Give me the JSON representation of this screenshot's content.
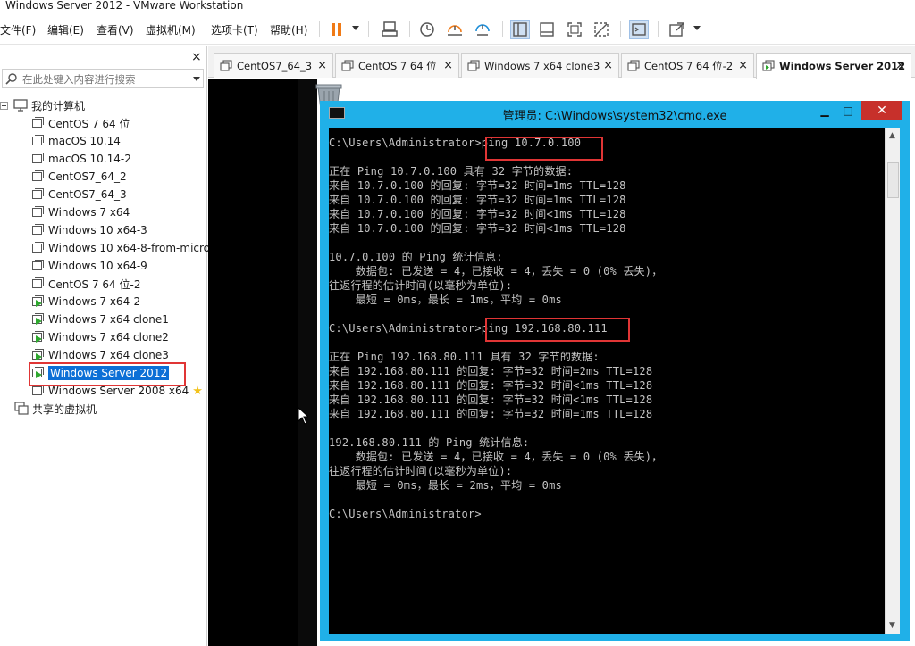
{
  "window": {
    "title": "Windows Server 2012 - VMware Workstation"
  },
  "menu": {
    "items": [
      "文件(F)",
      "编辑(E)",
      "查看(V)",
      "虚拟机(M)",
      "选项卡(T)",
      "帮助(H)"
    ]
  },
  "toolbar": {
    "icons": [
      "pause-icon",
      "send-ctrl-alt-del-icon",
      "snapshot-icon",
      "revert-snapshot-icon",
      "manage-snapshots-icon",
      "show-library-icon",
      "thumbnail-bar-icon",
      "full-screen-icon",
      "unity-icon",
      "console-view-icon",
      "stretch-guest-icon"
    ]
  },
  "sidebar": {
    "close_glyph": "×",
    "search_placeholder": "在此处键入内容进行搜索",
    "root_label": "我的计算机",
    "vms": [
      {
        "label": "CentOS 7 64 位",
        "running": false
      },
      {
        "label": "macOS 10.14",
        "running": false
      },
      {
        "label": "macOS 10.14-2",
        "running": false
      },
      {
        "label": "CentOS7_64_2",
        "running": false
      },
      {
        "label": "CentOS7_64_3",
        "running": false
      },
      {
        "label": "Windows 7 x64",
        "running": false
      },
      {
        "label": "Windows 10 x64-3",
        "running": false
      },
      {
        "label": "Windows 10 x64-8-from-micro",
        "running": false
      },
      {
        "label": "Windows 10 x64-9",
        "running": false
      },
      {
        "label": "CentOS 7 64 位-2",
        "running": false
      },
      {
        "label": "Windows 7 x64-2",
        "running": true
      },
      {
        "label": "Windows 7 x64 clone1",
        "running": true
      },
      {
        "label": "Windows 7 x64 clone2",
        "running": true
      },
      {
        "label": "Windows 7 x64 clone3",
        "running": true
      },
      {
        "label": "Windows Server 2012",
        "running": true,
        "selected": true
      },
      {
        "label": "Windows Server 2008 x64",
        "running": false,
        "favorite": true
      }
    ],
    "shared_label": "共享的虚拟机"
  },
  "tabs": [
    {
      "label": "CentOS7_64_3"
    },
    {
      "label": "CentOS 7 64 位"
    },
    {
      "label": "Windows 7 x64 clone3"
    },
    {
      "label": "CentOS 7 64 位-2"
    },
    {
      "label": "Windows Server 2012",
      "active": true
    }
  ],
  "cmd": {
    "title": "管理员: C:\\Windows\\system32\\cmd.exe",
    "btn_min": "▁",
    "btn_max": "□",
    "btn_close": "✕",
    "lines": [
      "C:\\Users\\Administrator>ping 10.7.0.100",
      "",
      "正在 Ping 10.7.0.100 具有 32 字节的数据:",
      "来自 10.7.0.100 的回复: 字节=32 时间=1ms TTL=128",
      "来自 10.7.0.100 的回复: 字节=32 时间=1ms TTL=128",
      "来自 10.7.0.100 的回复: 字节=32 时间<1ms TTL=128",
      "来自 10.7.0.100 的回复: 字节=32 时间<1ms TTL=128",
      "",
      "10.7.0.100 的 Ping 统计信息:",
      "    数据包: 已发送 = 4，已接收 = 4，丢失 = 0 (0% 丢失)，",
      "往返行程的估计时间(以毫秒为单位):",
      "    最短 = 0ms，最长 = 1ms，平均 = 0ms",
      "",
      "C:\\Users\\Administrator>ping 192.168.80.111",
      "",
      "正在 Ping 192.168.80.111 具有 32 字节的数据:",
      "来自 192.168.80.111 的回复: 字节=32 时间=2ms TTL=128",
      "来自 192.168.80.111 的回复: 字节=32 时间<1ms TTL=128",
      "来自 192.168.80.111 的回复: 字节=32 时间<1ms TTL=128",
      "来自 192.168.80.111 的回复: 字节=32 时间=1ms TTL=128",
      "",
      "192.168.80.111 的 Ping 统计信息:",
      "    数据包: 已发送 = 4，已接收 = 4，丢失 = 0 (0% 丢失)，",
      "往返行程的估计时间(以毫秒为单位):",
      "    最短 = 0ms，最长 = 2ms，平均 = 0ms",
      "",
      "C:\\Users\\Administrator>"
    ]
  },
  "colors": {
    "highlight_box": "#e03535",
    "selection": "#0c6fd6",
    "cmd_frame": "#20b0e8",
    "console_bg": "#000000",
    "console_text": "#c4c4c4"
  }
}
